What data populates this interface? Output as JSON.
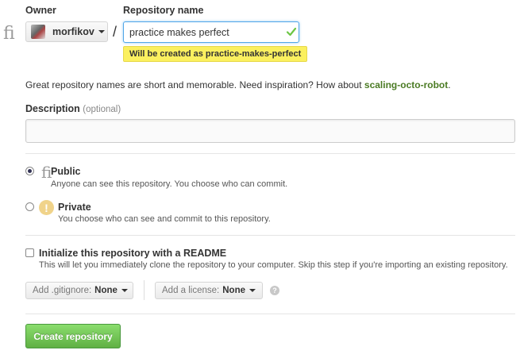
{
  "owner": {
    "label": "Owner",
    "value": "morfikov",
    "avatar_icon": "user-avatar"
  },
  "repo": {
    "label": "Repository name",
    "value": "practice makes perfect",
    "separator": "/",
    "flash": "Will be created as practice-makes-perfect",
    "check_icon": "checkmark-icon"
  },
  "tip": {
    "text": "Great repository names are short and memorable. Need inspiration? How about ",
    "suggestion": "scaling-octo-robot",
    "end": "."
  },
  "description": {
    "label": "Description",
    "optional": "(optional)",
    "value": ""
  },
  "visibility": {
    "public": {
      "title": "Public",
      "desc": "Anyone can see this repository. You choose who can commit.",
      "selected": true,
      "icon": "repo-icon"
    },
    "private": {
      "title": "Private",
      "desc": "You choose who can see and commit to this repository.",
      "selected": false,
      "icon": "lock-warning-icon"
    }
  },
  "init": {
    "title": "Initialize this repository with a README",
    "desc": "This will let you immediately clone the repository to your computer. Skip this step if you're importing an existing repository.",
    "checked": false
  },
  "gitignore": {
    "label": "Add .gitignore:",
    "value": "None"
  },
  "license": {
    "label": "Add a license:",
    "value": "None"
  },
  "help_glyph": "?",
  "private_glyph": "!",
  "create_button": "Create repository",
  "colors": {
    "accent_blue": "#51a7e8",
    "success_green": "#6cc644",
    "flash_yellow": "#fbf05f",
    "suggestion_green": "#4b7b24"
  }
}
